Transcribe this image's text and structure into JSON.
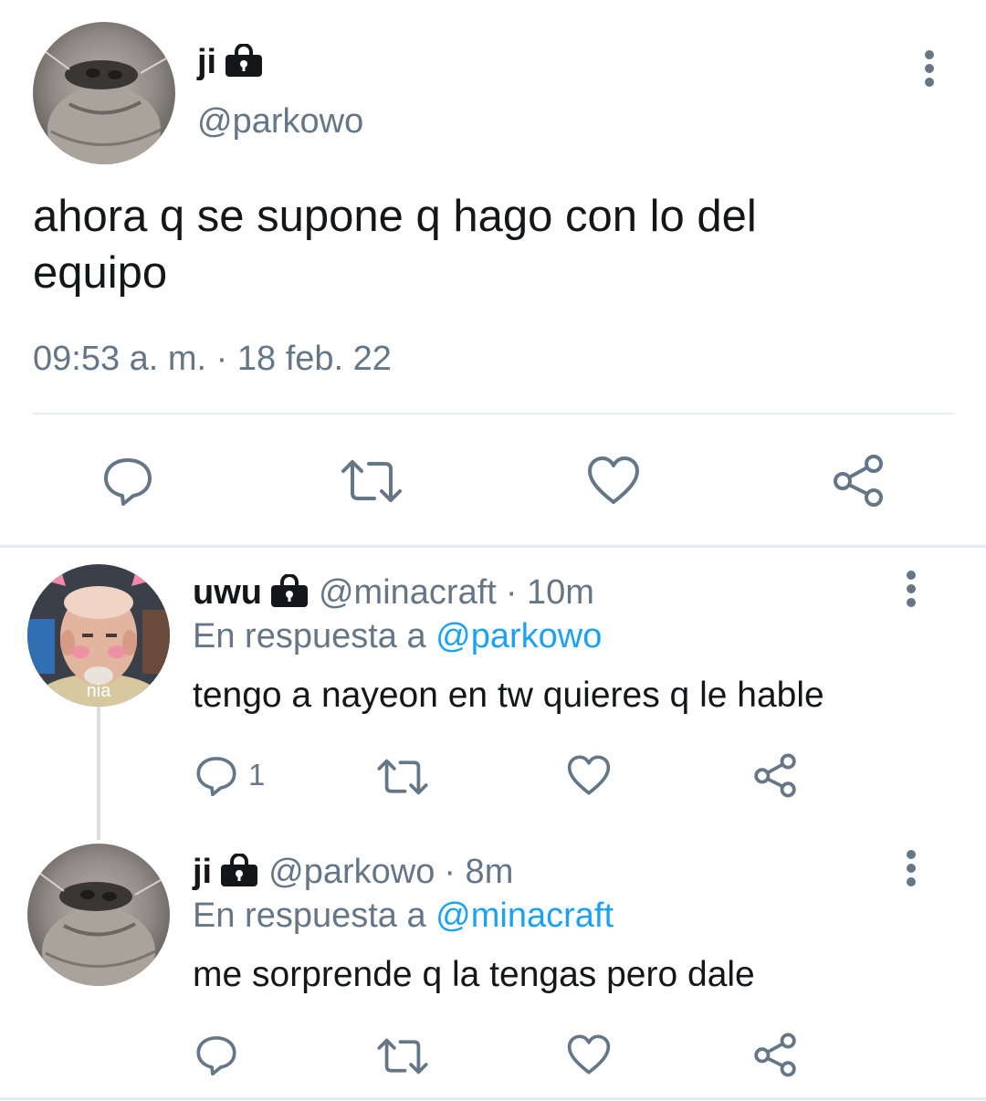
{
  "main_tweet": {
    "display_name": "ji",
    "handle": "@parkowo",
    "text": "ahora q se supone q hago con lo del equipo",
    "timestamp": "09:53 a. m. · 18 feb. 22",
    "avatar_icon": "cat-avatar",
    "protected_icon": "lock-icon"
  },
  "replies": [
    {
      "display_name": "uwu",
      "handle": "@minacraft",
      "time": "· 10m",
      "replying_prefix": "En respuesta a",
      "replying_to": "@parkowo",
      "text": "tengo a nayeon en tw quieres q le hable",
      "reply_count": "1",
      "avatar_caption": "nia",
      "avatar_icon": "person-avatar"
    },
    {
      "display_name": "ji",
      "handle": "@parkowo",
      "time": "· 8m",
      "replying_prefix": "En respuesta a",
      "replying_to": "@minacraft",
      "text": "me sorprende q la tengas pero dale",
      "reply_count": "",
      "avatar_icon": "cat-avatar"
    }
  ],
  "colors": {
    "text": "#14171a",
    "secondary": "#657786",
    "link": "#1da1f2",
    "divider": "#e6ecf0"
  }
}
